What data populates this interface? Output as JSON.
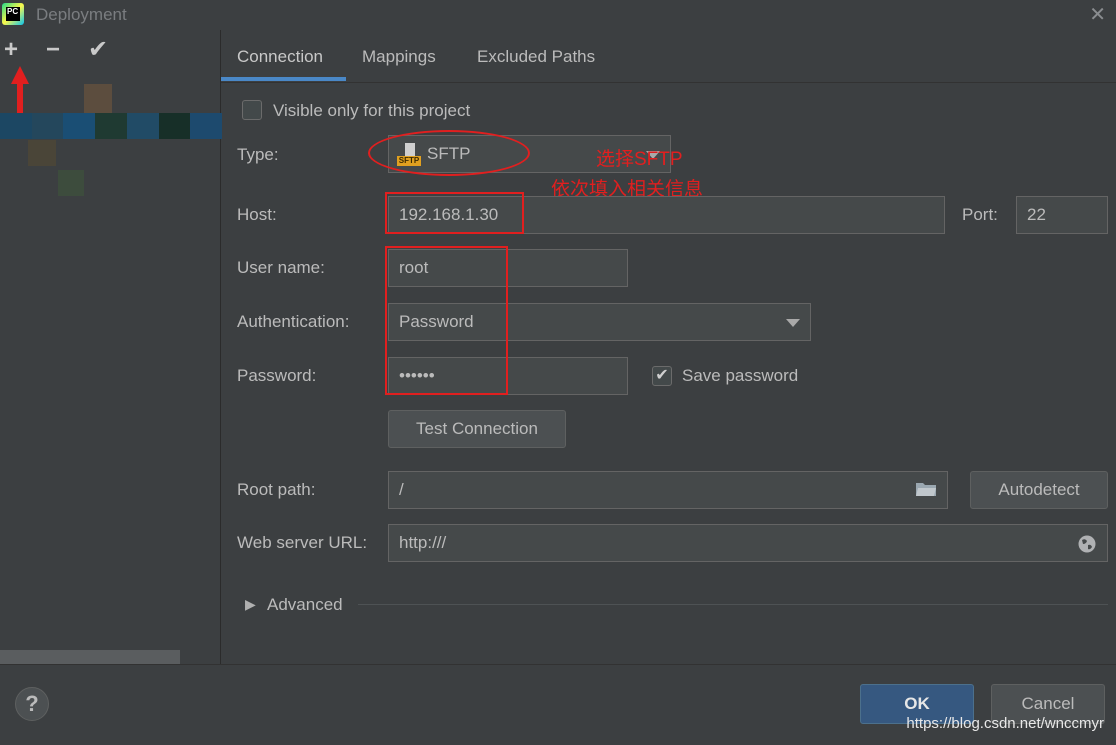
{
  "window": {
    "title": "Deployment",
    "app_icon_text": "PC"
  },
  "tabs": [
    {
      "label": "Connection",
      "active": true
    },
    {
      "label": "Mappings",
      "active": false
    },
    {
      "label": "Excluded Paths",
      "active": false
    }
  ],
  "form": {
    "visible_only_label": "Visible only for this project",
    "visible_only_checked": false,
    "type_label": "Type:",
    "type_value": "SFTP",
    "sftp_badge": "SFTP",
    "host_label": "Host:",
    "host_value": "192.168.1.30",
    "port_label": "Port:",
    "port_value": "22",
    "username_label": "User name:",
    "username_value": "root",
    "auth_label": "Authentication:",
    "auth_value": "Password",
    "password_label": "Password:",
    "password_value": "••••••",
    "save_password_label": "Save password",
    "save_password_checked": true,
    "test_connection_label": "Test Connection",
    "root_path_label": "Root path:",
    "root_path_value": "/",
    "autodetect_label": "Autodetect",
    "web_url_label": "Web server URL:",
    "web_url_value": "http:///",
    "advanced_label": "Advanced"
  },
  "annotations": {
    "line1": "选择SFTP",
    "line2": "依次填入相关信息"
  },
  "footer": {
    "help_label": "?",
    "ok_label": "OK",
    "cancel_label": "Cancel",
    "watermark": "https://blog.csdn.net/wnccmyr"
  },
  "colors": {
    "background": "#3c3f41",
    "accent": "#4a88c7",
    "annotation_red": "#e11f1f",
    "ok_button": "#365880"
  }
}
